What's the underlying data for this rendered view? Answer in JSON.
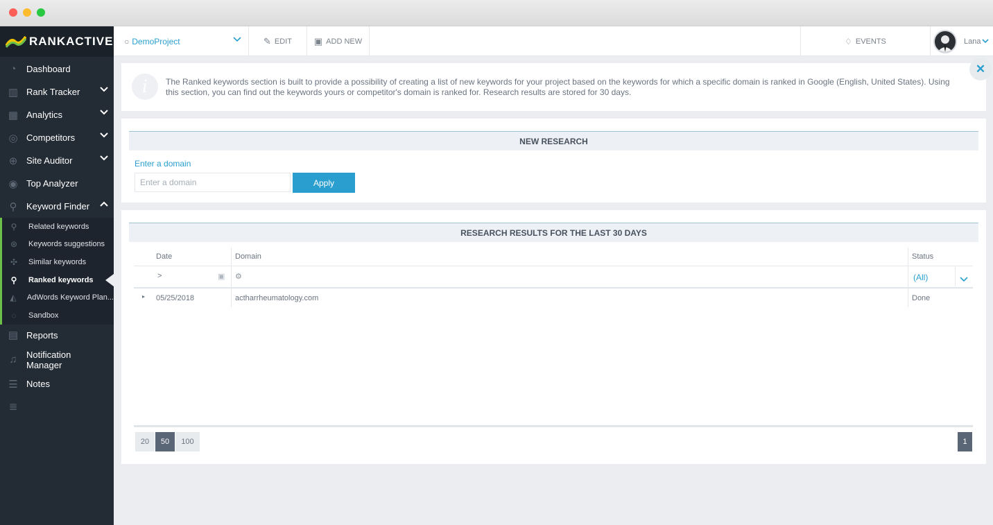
{
  "window": {
    "controls": [
      "close",
      "minimize",
      "maximize"
    ]
  },
  "brand": {
    "name": "RANKACTIVE",
    "accent": "#6cc04a",
    "primary": "#2a9fcf"
  },
  "sidebar": {
    "items": [
      {
        "label": "Dashboard",
        "icon": "dashboard-icon"
      },
      {
        "label": "Rank Tracker",
        "icon": "bar-chart-icon",
        "expandable": true
      },
      {
        "label": "Analytics",
        "icon": "analytics-icon",
        "expandable": true
      },
      {
        "label": "Competitors",
        "icon": "target-icon",
        "expandable": true
      },
      {
        "label": "Site Auditor",
        "icon": "audit-icon",
        "expandable": true
      },
      {
        "label": "Top Analyzer",
        "icon": "analyzer-icon"
      },
      {
        "label": "Keyword Finder",
        "icon": "key-icon",
        "expanded": true
      }
    ],
    "sub_items": [
      {
        "label": "Related keywords",
        "icon": "search-icon"
      },
      {
        "label": "Keywords suggestions",
        "icon": "suggestions-icon"
      },
      {
        "label": "Similar keywords",
        "icon": "similar-icon"
      },
      {
        "label": "Ranked keywords",
        "icon": "ranked-search-icon",
        "active": true
      },
      {
        "label": "AdWords Keyword Plan...",
        "icon": "adwords-icon"
      },
      {
        "label": "Sandbox",
        "icon": "sandbox-icon"
      }
    ],
    "bottom_items": [
      {
        "label": "Reports",
        "icon": "reports-icon"
      },
      {
        "label": "Notification Manager",
        "icon": "bell-icon"
      },
      {
        "label": "Notes",
        "icon": "notes-icon"
      }
    ]
  },
  "topbar": {
    "project": "DemoProject",
    "edit": "EDIT",
    "add_new": "ADD NEW",
    "events": "EVENTS",
    "user": "Lana"
  },
  "info": {
    "text": "The Ranked keywords section is built to provide a possibility of creating a list of new keywords for your project based on the keywords for which a specific domain is ranked in Google (English, United States). Using this section, you can find out the keywords yours or competitor's domain is ranked for. Research results are stored for 30 days.",
    "close": "✕"
  },
  "new_research": {
    "title": "NEW RESEARCH",
    "field_label": "Enter a domain",
    "placeholder": "Enter a domain",
    "apply": "Apply"
  },
  "results": {
    "title": "RESEARCH RESULTS FOR THE LAST 30 DAYS",
    "columns": [
      "Date",
      "Domain",
      "Status"
    ],
    "filter": {
      "date": ">",
      "status": "(All)"
    },
    "rows": [
      {
        "date": "05/25/2018",
        "domain": "actharrheumatology.com",
        "status": "Done"
      }
    ],
    "page_sizes": [
      "20",
      "50",
      "100"
    ],
    "active_page_size": "50",
    "pages": [
      "1"
    ]
  }
}
